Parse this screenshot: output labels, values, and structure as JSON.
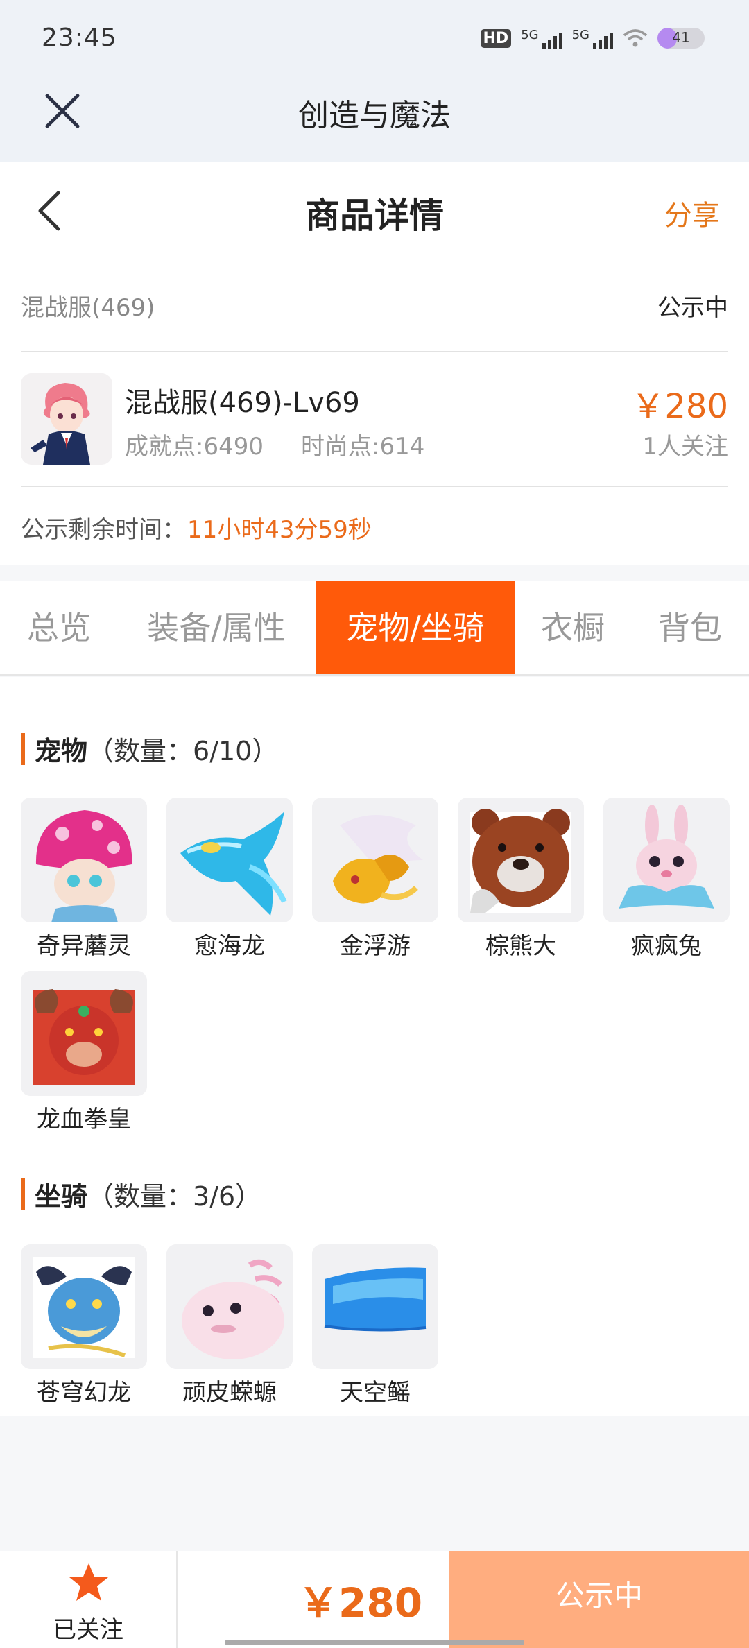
{
  "status_bar": {
    "time": "23:45",
    "hd_label": "HD",
    "signal1_label": "5G",
    "signal2_label": "5G",
    "battery": "41",
    "battery_level": 0.41
  },
  "mini_app": {
    "title": "创造与魔法"
  },
  "header": {
    "title": "商品详情",
    "share_label": "分享"
  },
  "listing": {
    "server": "混战服(469)",
    "status": "公示中",
    "name": "混战服(469)-Lv69",
    "achievement": "成就点:6490",
    "fashion": "时尚点:614",
    "price": "￥280",
    "followers": "1人关注",
    "remain_label": "公示剩余时间：",
    "remain_value": "11小时43分59秒"
  },
  "tabs": [
    {
      "label": "总览",
      "active": false
    },
    {
      "label": "装备/属性",
      "active": false
    },
    {
      "label": "宠物/坐骑",
      "active": true
    },
    {
      "label": "衣橱",
      "active": false
    },
    {
      "label": "背包",
      "active": false
    }
  ],
  "pets": {
    "title": "宠物",
    "count": "（数量：6/10）",
    "items": [
      {
        "name": "奇异蘑灵",
        "icon": "mushroom-pet-icon"
      },
      {
        "name": "愈海龙",
        "icon": "sea-dragon-pet-icon"
      },
      {
        "name": "金浮游",
        "icon": "golden-dragon-pet-icon"
      },
      {
        "name": "棕熊大",
        "icon": "brown-bear-pet-icon"
      },
      {
        "name": "疯疯兔",
        "icon": "rabbit-pet-icon"
      },
      {
        "name": "龙血拳皇",
        "icon": "horned-beast-pet-icon"
      }
    ]
  },
  "mounts": {
    "title": "坐骑",
    "count": "（数量：3/6）",
    "items": [
      {
        "name": "苍穹幻龙",
        "icon": "sky-dragon-mount-icon"
      },
      {
        "name": "顽皮蝾螈",
        "icon": "axolotl-mount-icon"
      },
      {
        "name": "天空鳐",
        "icon": "sky-ray-mount-icon"
      }
    ]
  },
  "bottom_bar": {
    "follow_label": "已关注",
    "price": "￥280",
    "action_label": "公示中"
  },
  "colors": {
    "accent": "#ea6a1a",
    "tab_active": "#ff5a0a",
    "action_button": "#ffad7f"
  }
}
